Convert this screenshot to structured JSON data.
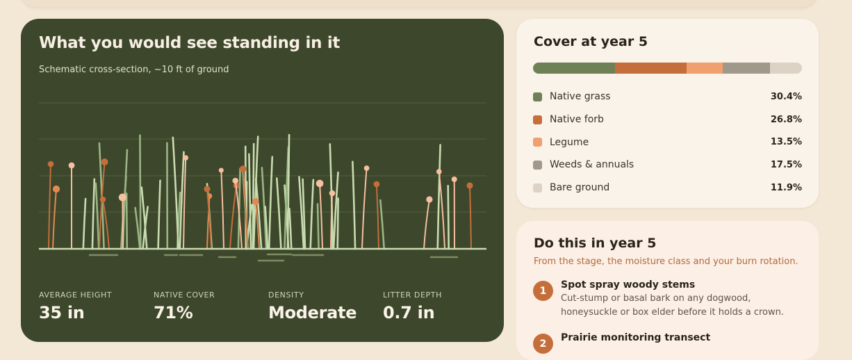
{
  "standing": {
    "title": "What you would see standing in it",
    "subtitle": "Schematic cross-section, ~10 ft of ground",
    "stats": [
      {
        "label": "AVERAGE HEIGHT",
        "value": "35 in"
      },
      {
        "label": "NATIVE COVER",
        "value": "71%"
      },
      {
        "label": "DENSITY",
        "value": "Moderate"
      },
      {
        "label": "LITTER DEPTH",
        "value": "0.7 in"
      }
    ]
  },
  "cover": {
    "title": "Cover at year 5",
    "items": [
      {
        "label": "Native grass",
        "pct": "30.4%",
        "value": 30.4,
        "color": "#6e8055"
      },
      {
        "label": "Native forb",
        "pct": "26.8%",
        "value": 26.8,
        "color": "#c46f3b"
      },
      {
        "label": "Legume",
        "pct": "13.5%",
        "value": 13.5,
        "color": "#f0a06e"
      },
      {
        "label": "Weeds & annuals",
        "pct": "17.5%",
        "value": 17.5,
        "color": "#a0988a"
      },
      {
        "label": "Bare ground",
        "pct": "11.9%",
        "value": 11.9,
        "color": "#dcd3c5"
      }
    ]
  },
  "todo": {
    "title": "Do this in year 5",
    "subtitle": "From the stage, the moisture class and your burn rotation.",
    "steps": [
      {
        "num": "1",
        "title": "Spot spray woody stems",
        "desc": "Cut-stump or basal bark on any dogwood, honeysuckle or box elder before it holds a crown."
      },
      {
        "num": "2",
        "title": "Prairie monitoring transect",
        "desc": ""
      }
    ]
  },
  "colors": {
    "card_dark": "#3d472c",
    "grass_light": "#c9dcb0",
    "grass_mid": "#9bb585",
    "forb_orange": "#e38a52",
    "forb_dark": "#c46f3b",
    "legume_peach": "#f6c0a0"
  }
}
